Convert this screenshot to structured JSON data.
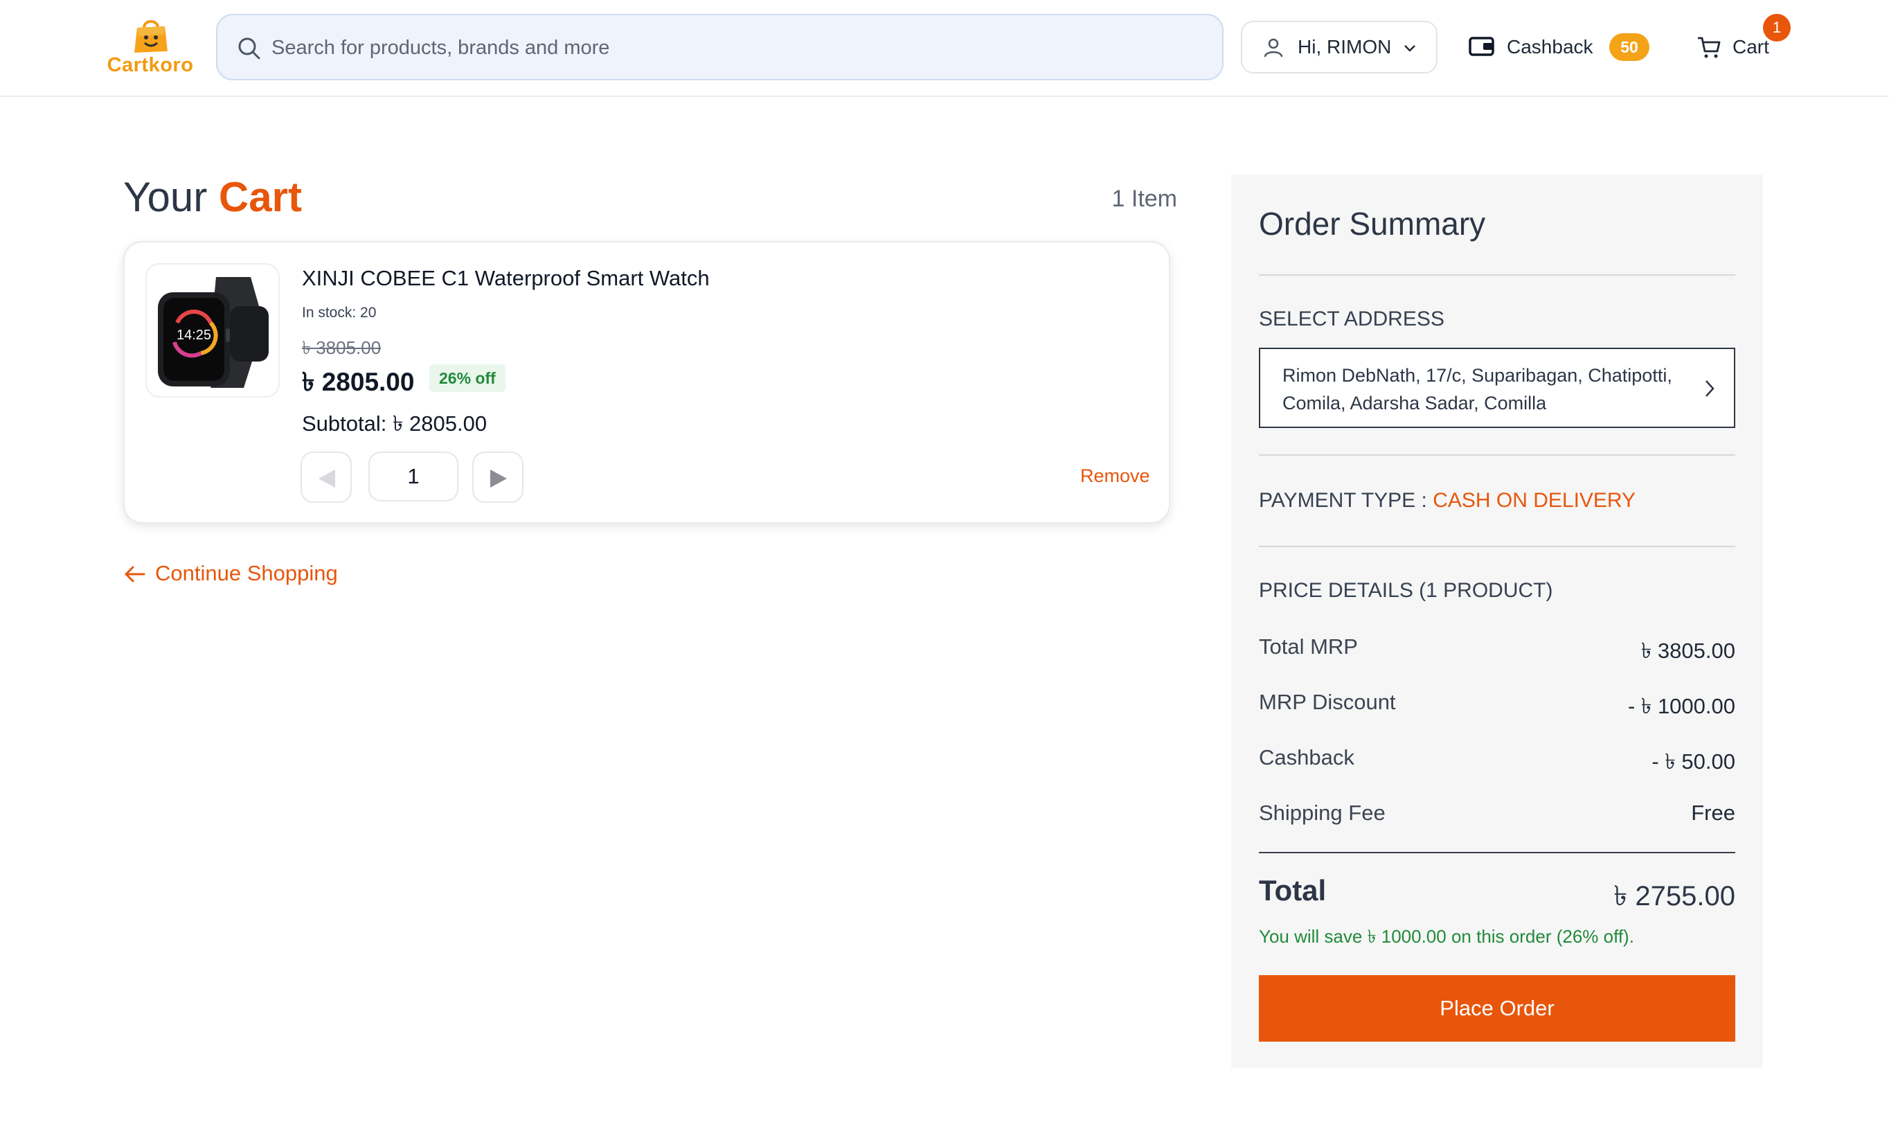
{
  "brand": {
    "name": "Cartkoro",
    "accent": "#e8560b",
    "logo_color": "#f29a10"
  },
  "header": {
    "search_placeholder": "Search for products, brands and more",
    "user_label": "Hi, RIMON",
    "cashback_label": "Cashback",
    "cashback_amount": "50",
    "cart_label": "Cart",
    "cart_count": "1"
  },
  "cart": {
    "title_prefix": "Your",
    "title_accent": "Cart",
    "item_count": "1 Item",
    "items": [
      {
        "name": "XINJI COBEE C1 Waterproof Smart Watch",
        "stock": "In stock: 20",
        "old_price": "৳ 3805.00",
        "price": "৳ 2805.00",
        "discount": "26% off",
        "subtotal": "Subtotal: ৳ 2805.00",
        "quantity": "1",
        "remove_label": "Remove",
        "watch_time": "14:25"
      }
    ],
    "continue_label": "Continue Shopping"
  },
  "summary": {
    "title": "Order Summary",
    "address_label": "SELECT ADDRESS",
    "address": "Rimon DebNath, 17/c, Suparibagan, Chatipotti, Comila, Adarsha Sadar, Comilla",
    "payment_label": "PAYMENT TYPE :",
    "payment_value": "CASH ON DELIVERY",
    "price_details_label": "PRICE DETAILS (1 PRODUCT)",
    "rows": [
      {
        "label": "Total MRP",
        "value": "৳ 3805.00"
      },
      {
        "label": "MRP Discount",
        "value": "- ৳ 1000.00"
      },
      {
        "label": "Cashback",
        "value": "- ৳ 50.00"
      },
      {
        "label": "Shipping Fee",
        "value": "Free"
      }
    ],
    "total_label": "Total",
    "total_value": "৳ 2755.00",
    "savings_text": "You will save ৳ 1000.00 on this order (26% off).",
    "place_order_label": "Place Order"
  }
}
